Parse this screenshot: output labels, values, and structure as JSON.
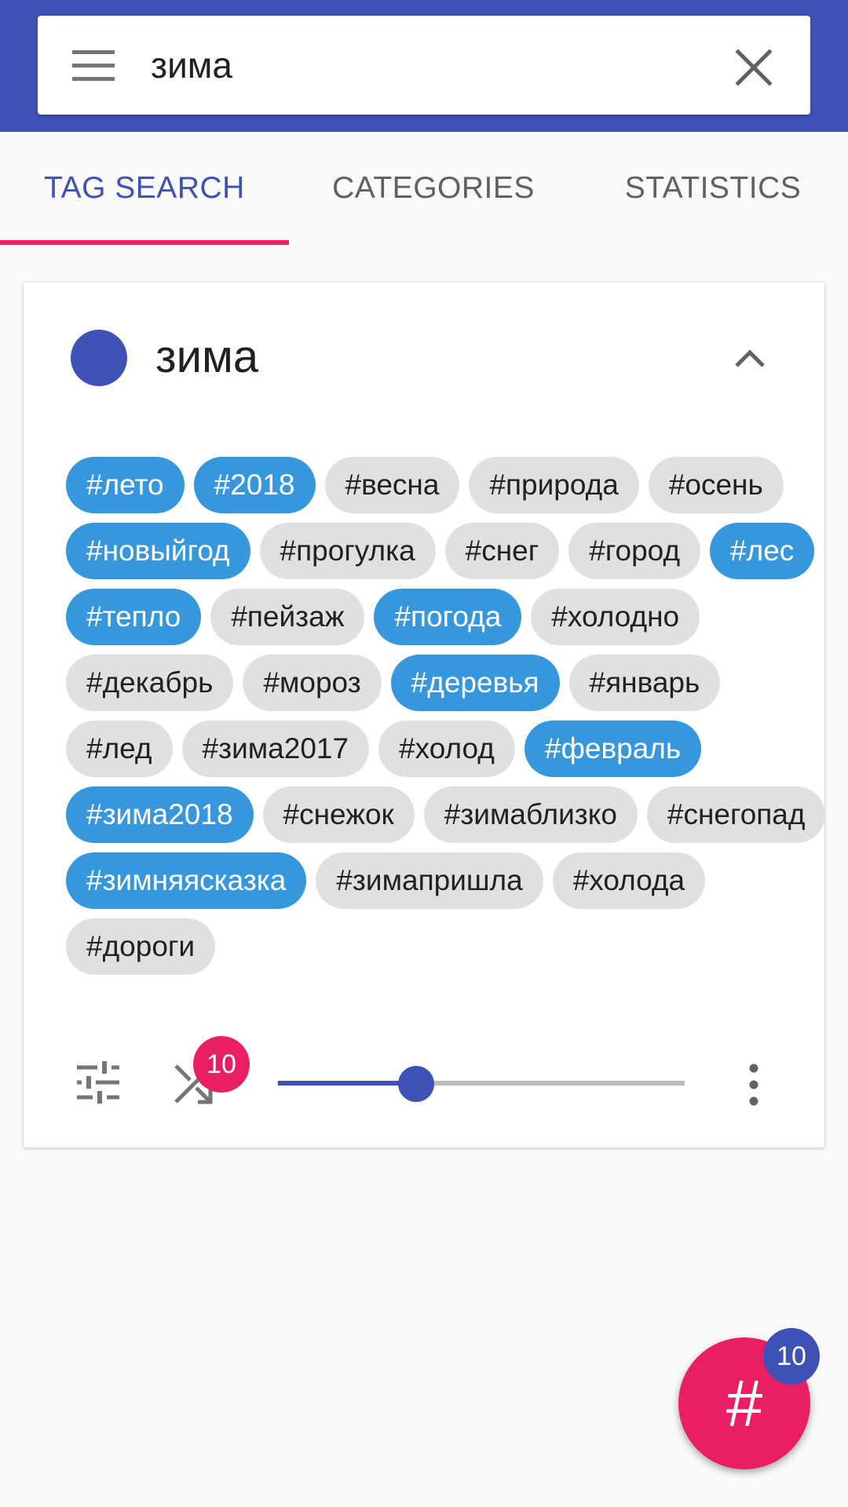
{
  "search": {
    "value": "зима"
  },
  "tabs": [
    {
      "label": "TAG SEARCH",
      "active": true
    },
    {
      "label": "CATEGORIES",
      "active": false
    },
    {
      "label": "STATISTICS",
      "active": false
    }
  ],
  "card": {
    "title": "зима",
    "dot_color": "#3f51b5",
    "tags": [
      {
        "label": "#лето",
        "selected": true
      },
      {
        "label": "#2018",
        "selected": true
      },
      {
        "label": "#весна",
        "selected": false
      },
      {
        "label": "#природа",
        "selected": false
      },
      {
        "label": "#осень",
        "selected": false
      },
      {
        "label": "#новыйгод",
        "selected": true
      },
      {
        "label": "#прогулка",
        "selected": false
      },
      {
        "label": "#снег",
        "selected": false
      },
      {
        "label": "#город",
        "selected": false
      },
      {
        "label": "#лес",
        "selected": true
      },
      {
        "label": "#тепло",
        "selected": true
      },
      {
        "label": "#пейзаж",
        "selected": false
      },
      {
        "label": "#погода",
        "selected": true
      },
      {
        "label": "#холодно",
        "selected": false
      },
      {
        "label": "#декабрь",
        "selected": false
      },
      {
        "label": "#мороз",
        "selected": false
      },
      {
        "label": "#деревья",
        "selected": true
      },
      {
        "label": "#январь",
        "selected": false
      },
      {
        "label": "#лед",
        "selected": false
      },
      {
        "label": "#зима2017",
        "selected": false
      },
      {
        "label": "#холод",
        "selected": false
      },
      {
        "label": "#февраль",
        "selected": true
      },
      {
        "label": "#зима2018",
        "selected": true
      },
      {
        "label": "#снежок",
        "selected": false
      },
      {
        "label": "#зимаблизко",
        "selected": false
      },
      {
        "label": "#снегопад",
        "selected": false
      },
      {
        "label": "#зимняясказка",
        "selected": true
      },
      {
        "label": "#зимапришла",
        "selected": false
      },
      {
        "label": "#холода",
        "selected": false
      },
      {
        "label": "#дороги",
        "selected": false
      }
    ],
    "controls": {
      "shuffle_count": "10",
      "slider_fraction": 0.34
    }
  },
  "fab": {
    "glyph": "#",
    "badge": "10"
  },
  "colors": {
    "primary": "#3f51b5",
    "accent": "#e91e63",
    "chip_selected": "#3797dd",
    "chip_default": "#e0e0e0"
  },
  "icons": [
    "menu-icon",
    "clear-icon",
    "chevron-up-icon",
    "tune-icon",
    "shuffle-icon",
    "more-vert-icon"
  ]
}
